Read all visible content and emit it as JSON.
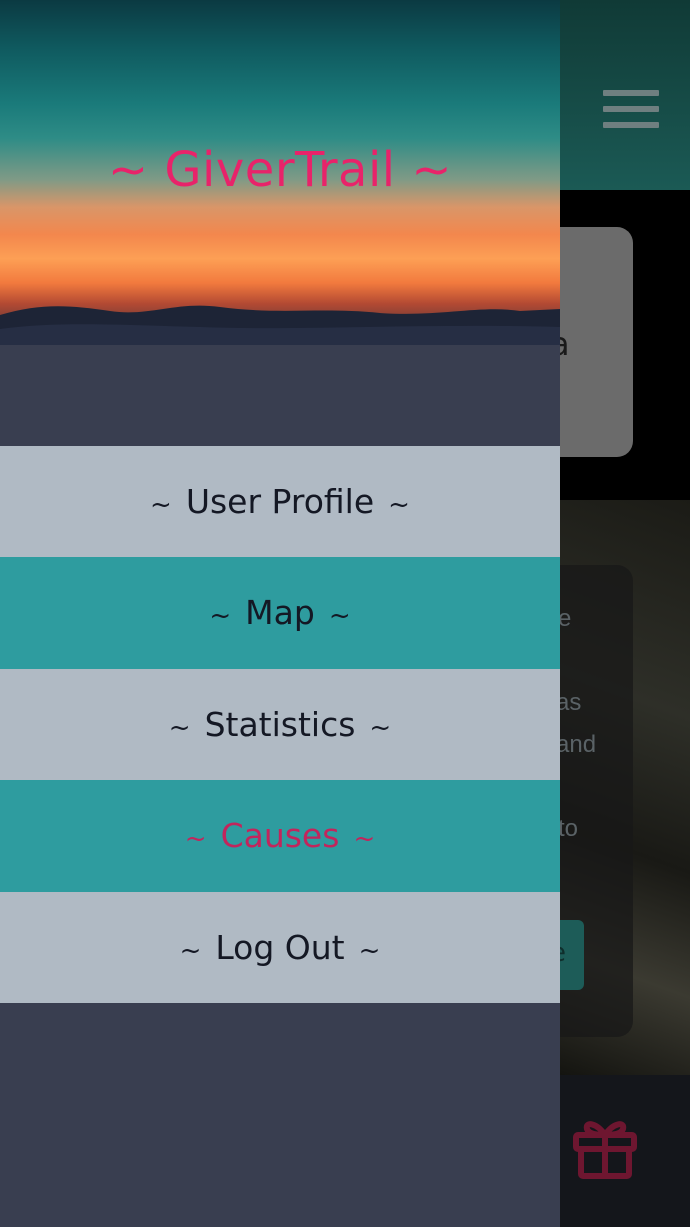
{
  "app": {
    "title": "GiverTrail",
    "menu_icon": "hamburger-menu-icon",
    "bottom_nav_icon": "gift-icon",
    "background_fragments": {
      "card_text": "a",
      "body_lines": [
        "e",
        "as",
        "and",
        "to"
      ],
      "button_text": "e"
    }
  },
  "drawer": {
    "header_title": "~ GiverTrail ~",
    "tilde": "~",
    "items": [
      {
        "label": "User Profile",
        "active": false
      },
      {
        "label": "Map",
        "active": false
      },
      {
        "label": "Statistics",
        "active": false
      },
      {
        "label": "Causes",
        "active": true
      },
      {
        "label": "Log Out",
        "active": false
      }
    ]
  },
  "colors": {
    "brand_pink": "#e8236a",
    "active_text": "#c2255c",
    "menu_light": "#b0bac4",
    "menu_teal": "#2e9c9f",
    "drawer_bg": "#393e50",
    "header_teal": "#1b5a55"
  }
}
